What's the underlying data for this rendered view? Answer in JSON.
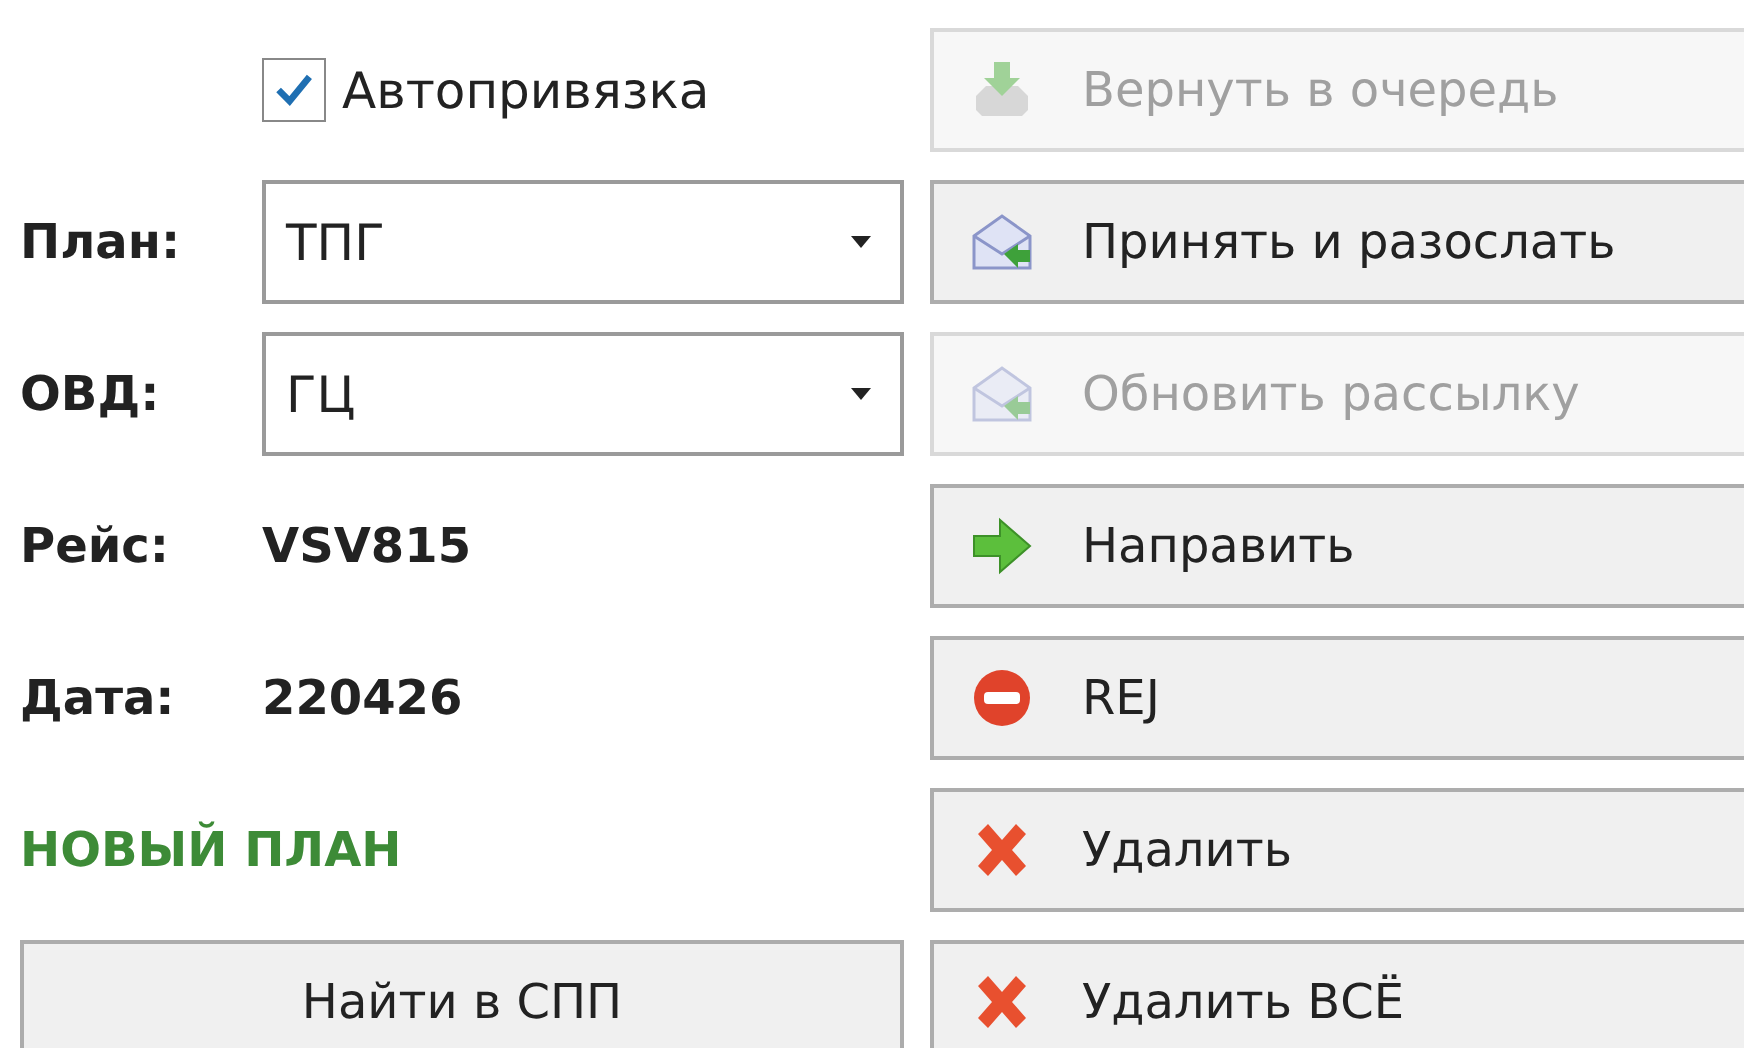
{
  "autobind": {
    "label": "Автопривязка",
    "checked": true
  },
  "plan": {
    "label": "План:",
    "value": "ТПГ"
  },
  "ovd": {
    "label": "ОВД:",
    "value": "ГЦ"
  },
  "flight": {
    "label": "Рейс:",
    "value": "VSV815"
  },
  "date": {
    "label": "Дата:",
    "value": "220426"
  },
  "status": "НОВЫЙ ПЛАН",
  "find_button": "Найти в СПП",
  "actions": [
    {
      "label": "Вернуть в очередь",
      "kind": "tray",
      "disabled": true
    },
    {
      "label": "Принять и разослать",
      "kind": "mail",
      "disabled": false
    },
    {
      "label": "Обновить рассылку",
      "kind": "mail",
      "disabled": true
    },
    {
      "label": "Направить",
      "kind": "arrow",
      "disabled": false
    },
    {
      "label": "REJ",
      "kind": "stop",
      "disabled": false
    },
    {
      "label": "Удалить",
      "kind": "cross",
      "disabled": false
    },
    {
      "label": "Удалить ВСЁ",
      "kind": "cross",
      "disabled": false
    }
  ]
}
